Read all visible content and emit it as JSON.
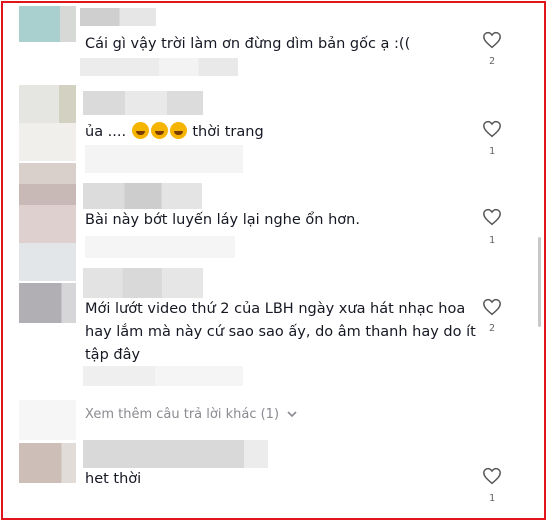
{
  "comments": [
    {
      "text": "Cái gì vậy trời làm ơn đừng dìm bản gốc ạ :((",
      "likes": "2"
    },
    {
      "text_before": "ủa ....",
      "text_after": "thời trang",
      "likes": "1"
    },
    {
      "text": "Bài này bớt luyến láy lại nghe ổn hơn.",
      "likes": "1"
    },
    {
      "lines": [
        "Mới lướt video thứ 2 của LBH ngày xưa hát nhạc hoa",
        "hay lắm mà này cứ sao sao ấy, do âm thanh hay do ít",
        "tập đây"
      ],
      "likes": "2"
    },
    {
      "text": "het thời",
      "likes": "1"
    }
  ],
  "view_more": {
    "label": "Xem thêm câu trả lời khác (1)",
    "icon": "chevron-down-icon"
  },
  "icons": {
    "like": "heart-outline-icon",
    "emoji": "rolling-laughing-emoji"
  },
  "colors": {
    "frame": "#e0151b",
    "text": "#161823",
    "muted": "#8a8b91"
  }
}
